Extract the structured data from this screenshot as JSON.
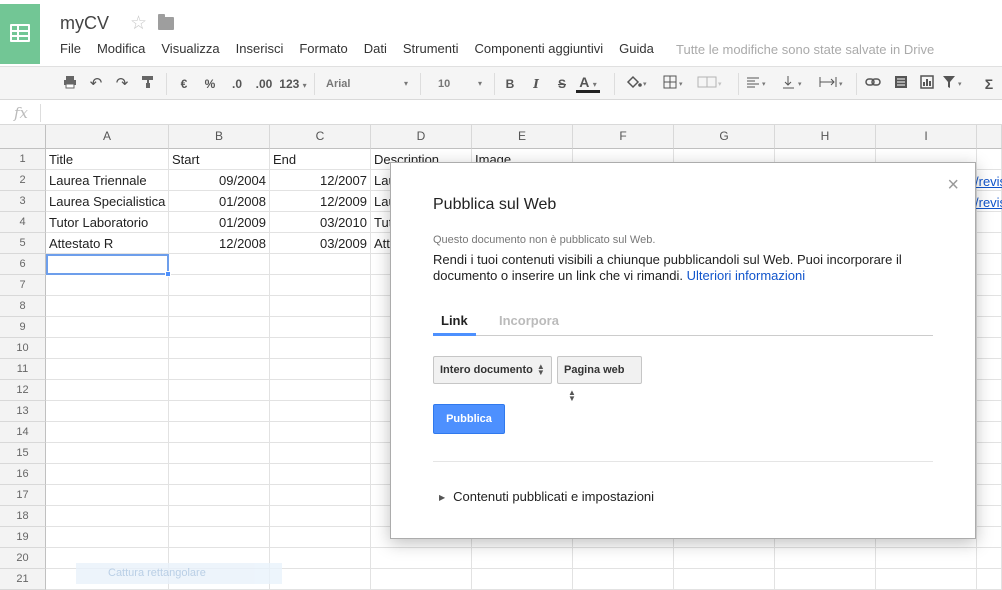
{
  "app": {
    "doc_title": "myCV",
    "save_status": "Tutte le modifiche sono state salvate in Drive"
  },
  "menu": [
    "File",
    "Modifica",
    "Visualizza",
    "Inserisci",
    "Formato",
    "Dati",
    "Strumenti",
    "Componenti aggiuntivi",
    "Guida"
  ],
  "toolbar": {
    "currency": "€",
    "percent": "%",
    "dec_less": ".0",
    "dec_more": ".00",
    "number_format": "123",
    "font": "Arial",
    "font_size": "10",
    "bold": "B",
    "italic": "I",
    "strike": "S",
    "text_color": "A",
    "text_color_value": "#222222"
  },
  "formula_bar": {
    "fx": "fx",
    "value": ""
  },
  "grid": {
    "columns": [
      "A",
      "B",
      "C",
      "D",
      "E",
      "F",
      "G",
      "H",
      "I"
    ],
    "rows": [
      "1",
      "2",
      "3",
      "4",
      "5",
      "6",
      "7",
      "8",
      "9",
      "10",
      "11",
      "12",
      "13",
      "14",
      "15",
      "16",
      "17",
      "18",
      "19",
      "20",
      "21"
    ],
    "cells": [
      [
        "Title",
        "Start",
        "End",
        "Description",
        "Image"
      ],
      [
        "Laurea Triennale",
        "09/2004",
        "12/2007",
        "Lau",
        ""
      ],
      [
        "Laurea Specialistica",
        "01/2008",
        "12/2009",
        "Lau",
        ""
      ],
      [
        "Tutor Laboratorio",
        "01/2009",
        "03/2010",
        "Tut",
        ""
      ],
      [
        "Attestato R",
        "12/2008",
        "03/2009",
        "Att",
        ""
      ]
    ],
    "peek_links": [
      "/revis",
      "/revis"
    ]
  },
  "dialog": {
    "title": "Pubblica sul Web",
    "status": "Questo documento non è pubblicato sul Web.",
    "description": "Rendi i tuoi contenuti visibili a chiunque pubblicandoli sul Web. Puoi incorporare il documento o inserire un link che vi rimandi.",
    "more_info": "Ulteriori informazioni",
    "tabs": {
      "link": "Link",
      "embed": "Incorpora"
    },
    "scope_select": "Intero documento",
    "format_select": "Pagina web",
    "publish_label": "Pubblica",
    "advanced_label": "Contenuti pubblicati e impostazioni",
    "close": "×"
  },
  "overlay": {
    "capture_hint": "Cattura rettangolare"
  },
  "colors": {
    "accent": "#4d90fe",
    "logo": "#72c695",
    "link": "#1155cc"
  }
}
